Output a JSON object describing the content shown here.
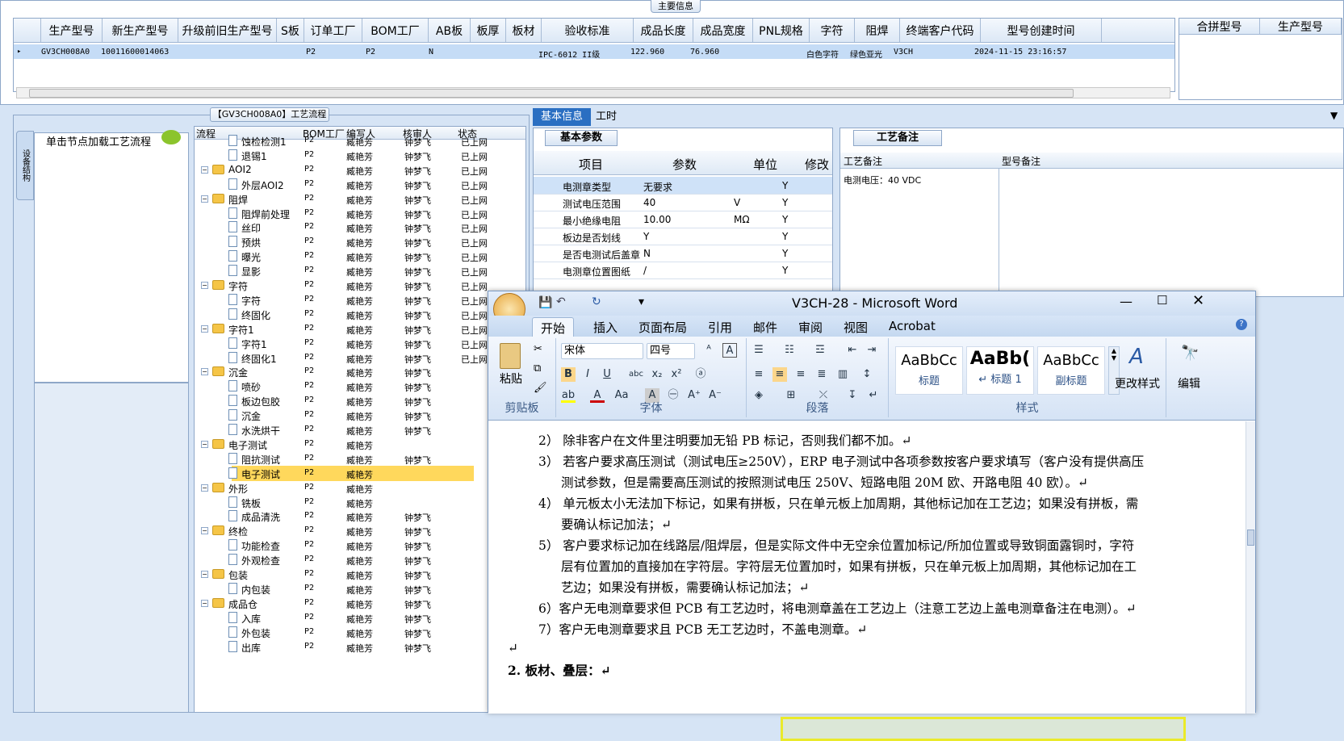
{
  "top": {
    "tab_label": "主要信息",
    "columns": [
      "生产型号",
      "新生产型号",
      "升级前旧生产型号",
      "S板",
      "订单工厂",
      "BOM工厂",
      "AB板",
      "板厚",
      "板材",
      "验收标准",
      "成品长度",
      "成品宽度",
      "PNL规格",
      "字符",
      "阻焊",
      "终端客户代码",
      "型号创建时间"
    ],
    "row": {
      "prod_model": "GV3CH008A0",
      "new_model": "10011600014063",
      "order_factory": "P2",
      "bom_factory": "P2",
      "ab_board": "N",
      "standard": "IPC-6012 II级",
      "length": "122.960",
      "width": "76.960",
      "char": "白色字符",
      "solder": "绿色亚光",
      "customer": "V3CH",
      "created": "2024-11-15 23:16:57"
    },
    "merge_cols": [
      "合拼型号",
      "生产型号"
    ]
  },
  "flow": {
    "title": "【GV3CH008A0】工艺流程",
    "side_tab": "设备结构",
    "load_text": "单击节点加载工艺流程",
    "tree_headers": [
      "流程",
      "BOM工厂",
      "编写人",
      "核审人",
      "状态"
    ],
    "nodes": [
      {
        "name": "蚀检检测1",
        "level": 2,
        "bom": "P2",
        "writer": "臧艳芳",
        "checker": "钟梦飞",
        "status": "已上网"
      },
      {
        "name": "退锡1",
        "level": 2,
        "bom": "P2",
        "writer": "臧艳芳",
        "checker": "钟梦飞",
        "status": "已上网"
      },
      {
        "name": "AOI2",
        "level": 1,
        "bom": "P2",
        "writer": "臧艳芳",
        "checker": "钟梦飞",
        "status": "已上网"
      },
      {
        "name": "外层AOI2",
        "level": 2,
        "bom": "P2",
        "writer": "臧艳芳",
        "checker": "钟梦飞",
        "status": "已上网"
      },
      {
        "name": "阻焊",
        "level": 1,
        "bom": "P2",
        "writer": "臧艳芳",
        "checker": "钟梦飞",
        "status": "已上网"
      },
      {
        "name": "阻焊前处理",
        "level": 2,
        "bom": "P2",
        "writer": "臧艳芳",
        "checker": "钟梦飞",
        "status": "已上网"
      },
      {
        "name": "丝印",
        "level": 2,
        "bom": "P2",
        "writer": "臧艳芳",
        "checker": "钟梦飞",
        "status": "已上网"
      },
      {
        "name": "预烘",
        "level": 2,
        "bom": "P2",
        "writer": "臧艳芳",
        "checker": "钟梦飞",
        "status": "已上网"
      },
      {
        "name": "曝光",
        "level": 2,
        "bom": "P2",
        "writer": "臧艳芳",
        "checker": "钟梦飞",
        "status": "已上网"
      },
      {
        "name": "显影",
        "level": 2,
        "bom": "P2",
        "writer": "臧艳芳",
        "checker": "钟梦飞",
        "status": "已上网"
      },
      {
        "name": "字符",
        "level": 1,
        "bom": "P2",
        "writer": "臧艳芳",
        "checker": "钟梦飞",
        "status": "已上网"
      },
      {
        "name": "字符",
        "level": 2,
        "bom": "P2",
        "writer": "臧艳芳",
        "checker": "钟梦飞",
        "status": "已上网"
      },
      {
        "name": "终固化",
        "level": 2,
        "bom": "P2",
        "writer": "臧艳芳",
        "checker": "钟梦飞",
        "status": "已上网"
      },
      {
        "name": "字符1",
        "level": 1,
        "bom": "P2",
        "writer": "臧艳芳",
        "checker": "钟梦飞",
        "status": "已上网"
      },
      {
        "name": "字符1",
        "level": 2,
        "bom": "P2",
        "writer": "臧艳芳",
        "checker": "钟梦飞",
        "status": "已上网"
      },
      {
        "name": "终固化1",
        "level": 2,
        "bom": "P2",
        "writer": "臧艳芳",
        "checker": "钟梦飞",
        "status": "已上网"
      },
      {
        "name": "沉金",
        "level": 1,
        "bom": "P2",
        "writer": "臧艳芳",
        "checker": "钟梦飞",
        "status": ""
      },
      {
        "name": "喷砂",
        "level": 2,
        "bom": "P2",
        "writer": "臧艳芳",
        "checker": "钟梦飞",
        "status": ""
      },
      {
        "name": "板边包胶",
        "level": 2,
        "bom": "P2",
        "writer": "臧艳芳",
        "checker": "钟梦飞",
        "status": ""
      },
      {
        "name": "沉金",
        "level": 2,
        "bom": "P2",
        "writer": "臧艳芳",
        "checker": "钟梦飞",
        "status": ""
      },
      {
        "name": "水洗烘干",
        "level": 2,
        "bom": "P2",
        "writer": "臧艳芳",
        "checker": "钟梦飞",
        "status": ""
      },
      {
        "name": "电子测试",
        "level": 1,
        "bom": "P2",
        "writer": "臧艳芳",
        "checker": "",
        "status": ""
      },
      {
        "name": "阻抗测试",
        "level": 2,
        "bom": "P2",
        "writer": "臧艳芳",
        "checker": "钟梦飞",
        "status": ""
      },
      {
        "name": "电子测试",
        "level": 2,
        "bom": "P2",
        "writer": "臧艳芳",
        "checker": "",
        "status": "",
        "selected": true
      },
      {
        "name": "外形",
        "level": 1,
        "bom": "P2",
        "writer": "臧艳芳",
        "checker": "",
        "status": ""
      },
      {
        "name": "铣板",
        "level": 2,
        "bom": "P2",
        "writer": "臧艳芳",
        "checker": "",
        "status": ""
      },
      {
        "name": "成品清洗",
        "level": 2,
        "bom": "P2",
        "writer": "臧艳芳",
        "checker": "钟梦飞",
        "status": ""
      },
      {
        "name": "终检",
        "level": 1,
        "bom": "P2",
        "writer": "臧艳芳",
        "checker": "钟梦飞",
        "status": ""
      },
      {
        "name": "功能检查",
        "level": 2,
        "bom": "P2",
        "writer": "臧艳芳",
        "checker": "钟梦飞",
        "status": ""
      },
      {
        "name": "外观检查",
        "level": 2,
        "bom": "P2",
        "writer": "臧艳芳",
        "checker": "钟梦飞",
        "status": ""
      },
      {
        "name": "包装",
        "level": 1,
        "bom": "P2",
        "writer": "臧艳芳",
        "checker": "钟梦飞",
        "status": ""
      },
      {
        "name": "内包装",
        "level": 2,
        "bom": "P2",
        "writer": "臧艳芳",
        "checker": "钟梦飞",
        "status": ""
      },
      {
        "name": "成品仓",
        "level": 1,
        "bom": "P2",
        "writer": "臧艳芳",
        "checker": "钟梦飞",
        "status": ""
      },
      {
        "name": "入库",
        "level": 2,
        "bom": "P2",
        "writer": "臧艳芳",
        "checker": "钟梦飞",
        "status": ""
      },
      {
        "name": "外包装",
        "level": 2,
        "bom": "P2",
        "writer": "臧艳芳",
        "checker": "钟梦飞",
        "status": ""
      },
      {
        "name": "出库",
        "level": 2,
        "bom": "P2",
        "writer": "臧艳芳",
        "checker": "钟梦飞",
        "status": ""
      }
    ]
  },
  "right": {
    "tabs": [
      "基本信息",
      "工时"
    ],
    "param_title": "基本参数",
    "param_headers": [
      "项目",
      "参数",
      "单位",
      "修改"
    ],
    "params": [
      {
        "item": "电测章类型",
        "value": "无要求",
        "unit": "",
        "mod": "Y"
      },
      {
        "item": "测试电压范围",
        "value": "40",
        "unit": "V",
        "mod": "Y"
      },
      {
        "item": "最小绝缘电阻",
        "value": "10.00",
        "unit": "MΩ",
        "mod": "Y"
      },
      {
        "item": "板边是否划线",
        "value": "Y",
        "unit": "",
        "mod": "Y"
      },
      {
        "item": "是否电测试后盖章",
        "value": "N",
        "unit": "",
        "mod": "Y"
      },
      {
        "item": "电测章位置图纸",
        "value": "/",
        "unit": "",
        "mod": "Y"
      }
    ],
    "note_title": "工艺备注",
    "note_headers": [
      "工艺备注",
      "型号备注"
    ],
    "note_text": "电测电压：40 VDC"
  },
  "word": {
    "title": "V3CH-28 - Microsoft Word",
    "tabs": [
      "开始",
      "插入",
      "页面布局",
      "引用",
      "邮件",
      "审阅",
      "视图",
      "Acrobat"
    ],
    "font": "宋体",
    "size": "四号",
    "groups": [
      "剪贴板",
      "字体",
      "段落",
      "样式"
    ],
    "paste": "粘贴",
    "styles": [
      {
        "sample": "AaBbCc",
        "name": "标题"
      },
      {
        "sample": "AaBb(",
        "name": "↵ 标题 1"
      },
      {
        "sample": "AaBbCc",
        "name": "副标题"
      }
    ],
    "change_style": "更改样式",
    "edit": "编辑",
    "lines": [
      "2）  除非客户在文件里注明要加无铅 PB 标记，否则我们都不加。↵",
      "3）  若客户要求高压测试（测试电压≥250V），ERP 电子测试中各项参数按客户要求填写（客户没有提供高压",
      "测试参数，但是需要高压测试的按照测试电压 250V、短路电阻 20M 欧、开路电阻 40 欧）。↵",
      "4）  单元板太小无法加下标记，如果有拼板，只在单元板上加周期，其他标记加在工艺边；如果没有拼板，需",
      "要确认标记加法；↵",
      "5）  客户要求标记加在线路层/阻焊层，但是实际文件中无空余位置加标记/所加位置或导致铜面露铜时，字符",
      "层有位置加的直接加在字符层。字符层无位置加时，如果有拼板，只在单元板上加周期，其他标记加在工",
      "艺边；如果没有拼板，需要确认标记加法；↵",
      "6）客户无电测章要求但 PCB 有工艺边时，将电测章盖在工艺边上（注意工艺边上盖电测章备注在电测）。↵",
      "7）客户无电测章要求且 PCB 无工艺边时，不盖电测章。↵",
      "↵",
      "2.   板材、叠层：↵"
    ]
  }
}
